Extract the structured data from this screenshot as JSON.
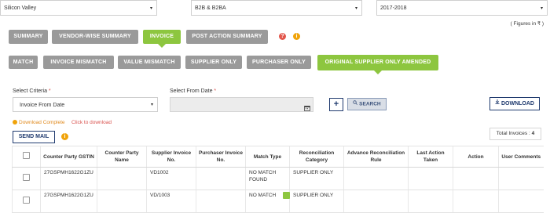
{
  "filters": {
    "region": "Silicon Valley",
    "type": "B2B & B2BA",
    "year": "2017-2018",
    "figures_note": "( Figures in ₹ )"
  },
  "tabs_row1": [
    {
      "label": "SUMMARY"
    },
    {
      "label": "VENDOR-WISE SUMMARY"
    },
    {
      "label": "INVOICE"
    },
    {
      "label": "POST ACTION SUMMARY"
    }
  ],
  "tabs_row2": [
    {
      "label": "MATCH"
    },
    {
      "label": "INVOICE MISMATCH"
    },
    {
      "label": "VALUE MISMATCH"
    },
    {
      "label": "SUPPLIER ONLY"
    },
    {
      "label": "PURCHASER ONLY"
    },
    {
      "label": "ORIGINAL SUPPLIER ONLY AMENDED"
    }
  ],
  "criteria": {
    "select_criteria_label": "Select Criteria",
    "select_criteria_value": "Invoice From Date",
    "select_from_date_label": "Select From Date",
    "from_date_value": "",
    "search_label": "SEARCH",
    "download_label": "DOWNLOAD",
    "add_symbol": "+",
    "required_mark": "*"
  },
  "status": {
    "download_complete": "Download Complete",
    "click_to_download": "Click to download",
    "send_mail": "SEND MAIL",
    "total_invoices": "Total Invoices : ",
    "total_invoices_count": "4"
  },
  "table": {
    "headers": {
      "counter_gstin": "Counter Party GSTIN",
      "counter_name": "Counter Party Name",
      "supplier_inv": "Supplier Invoice No.",
      "purchaser_inv": "Purchaser Invoice No.",
      "match_type": "Match Type",
      "recon_cat": "Reconciliation Category",
      "adv_rule": "Advance Reconciliation Rule",
      "last_action": "Last Action Taken",
      "action": "Action",
      "comments": "User Comments"
    },
    "rows": [
      {
        "gstin": "27GSPMH1622G1ZU",
        "name": "",
        "supplier_inv": "VD1002",
        "purchaser_inv": "",
        "match_type": "NO MATCH FOUND",
        "category": "SUPPLIER ONLY",
        "rule": "",
        "last_action": "",
        "action": "",
        "comments": ""
      },
      {
        "gstin": "27GSPMH1622G1ZU",
        "name": "",
        "supplier_inv": "VD/1003",
        "purchaser_inv": "",
        "match_type": "NO MATCH",
        "category": "SUPPLIER ONLY",
        "rule": "",
        "last_action": "",
        "action": "",
        "comments": ""
      }
    ]
  },
  "colors": {
    "accent_green": "#8dc63f",
    "tab_gray": "#9a9a9a",
    "navy": "#1f3a6e",
    "warning_orange": "#f0a30a",
    "help_red": "#e2574c"
  },
  "icons": {
    "caret": "▾",
    "help": "?",
    "info": "i",
    "calendar": "calendar-icon",
    "search": "search-icon",
    "download": "download-icon"
  }
}
